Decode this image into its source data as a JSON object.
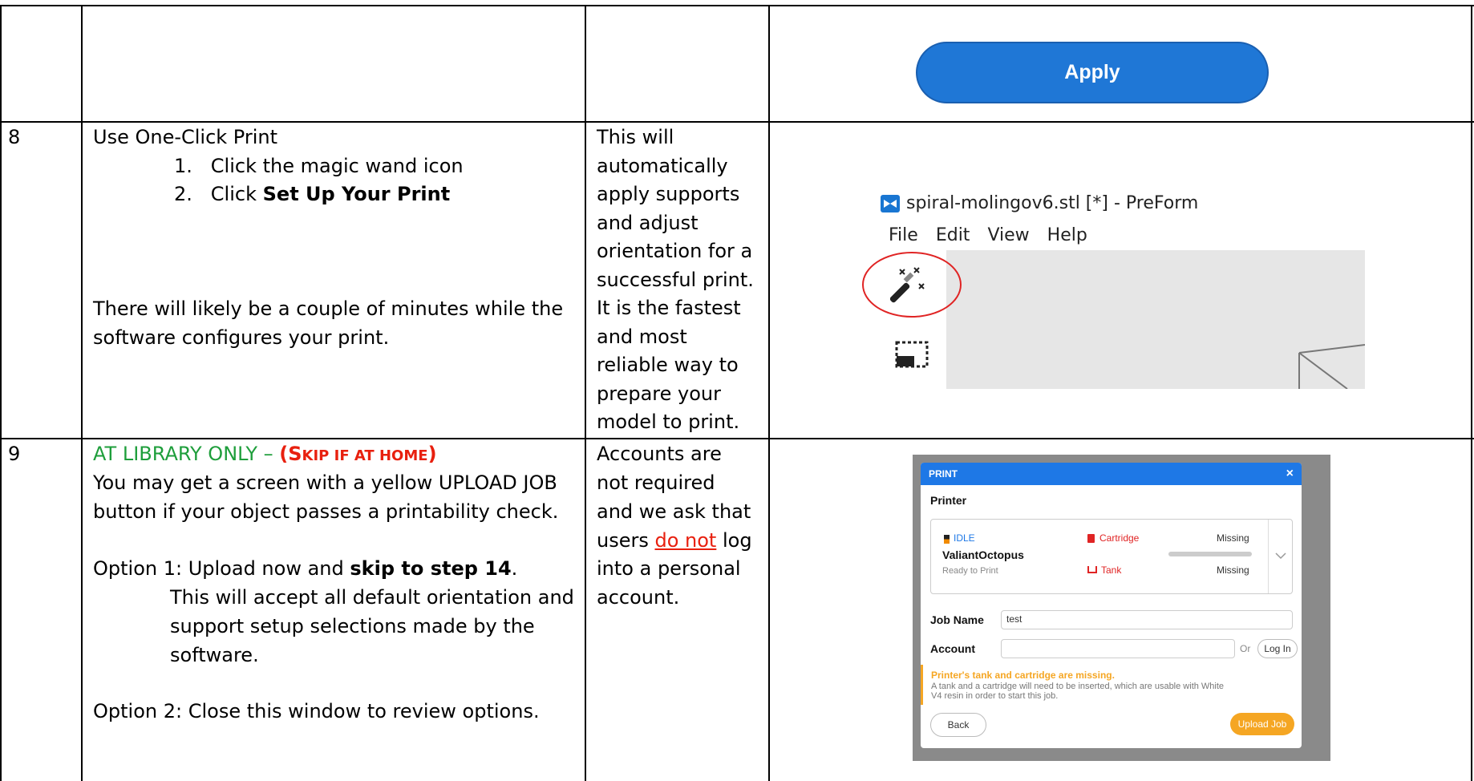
{
  "row_top": {
    "apply_label": "Apply"
  },
  "row8": {
    "step_number": "8",
    "heading": "Use One-Click Print",
    "items": [
      {
        "num": "1.",
        "text": "Click the magic wand icon"
      },
      {
        "num": "2.",
        "pre": "Click ",
        "bold": "Set Up Your Print"
      }
    ],
    "note_line1": "There will likely be a couple of minutes while the",
    "note_line2": "software configures your print.",
    "why_lines": [
      "This will",
      "automatically",
      "apply supports",
      "and adjust",
      "orientation for a",
      "successful print.",
      "It is the fastest",
      "and most",
      "reliable way to",
      "prepare your",
      "model to print."
    ],
    "preform": {
      "title": "spiral-molingov6.stl [*] - PreForm",
      "menu": [
        "File",
        "Edit",
        "View",
        "Help"
      ],
      "icons": [
        "magic-wand-icon",
        "layout-select-icon"
      ]
    }
  },
  "row9": {
    "step_number": "9",
    "heading_green": "AT LIBRARY ONLY – ",
    "heading_red_open": "(S",
    "heading_red_smallcaps": "KIP IF AT HOME",
    "heading_red_close": ")",
    "line1": "You may get a screen with a yellow UPLOAD JOB",
    "line2": "button if your object passes a printability check.",
    "option1_pre": "Option 1:  Upload now and ",
    "option1_bold": "skip to step 14",
    "option1_post": ".",
    "option1_sub1": "This will accept all default orientation and",
    "option1_sub2": "support setup selections made by the",
    "option1_sub3": "software.",
    "option2": "Option 2: Close this window to review options.",
    "why_line1": "Accounts are",
    "why_line2": "not required",
    "why_line3": "and we ask that",
    "why_line4_pre": "users ",
    "why_line4_u": "do not",
    "why_line4_post": " log",
    "why_line5": "into a personal",
    "why_line6": "account.",
    "dialog": {
      "header": "PRINT",
      "close": "×",
      "printer_label": "Printer",
      "status": "IDLE",
      "printer_name": "ValiantOctopus",
      "ready": "Ready to Print",
      "cartridge": "Cartridge",
      "cartridge_state": "Missing",
      "tank": "Tank",
      "tank_state": "Missing",
      "job_name_label": "Job Name",
      "job_name_value": "test",
      "account_label": "Account",
      "or": "Or",
      "login": "Log In",
      "warn_title": "Printer's tank and cartridge are missing.",
      "warn_text1": "A tank and a cartridge will need to be inserted, which are usable with White",
      "warn_text2": "V4 resin in order to start this job.",
      "back": "Back",
      "upload": "Upload Job",
      "colors": {
        "header": "#1e78e6",
        "upload": "#f5a623",
        "warn": "#f5a623",
        "missing": "#e02424"
      }
    }
  }
}
